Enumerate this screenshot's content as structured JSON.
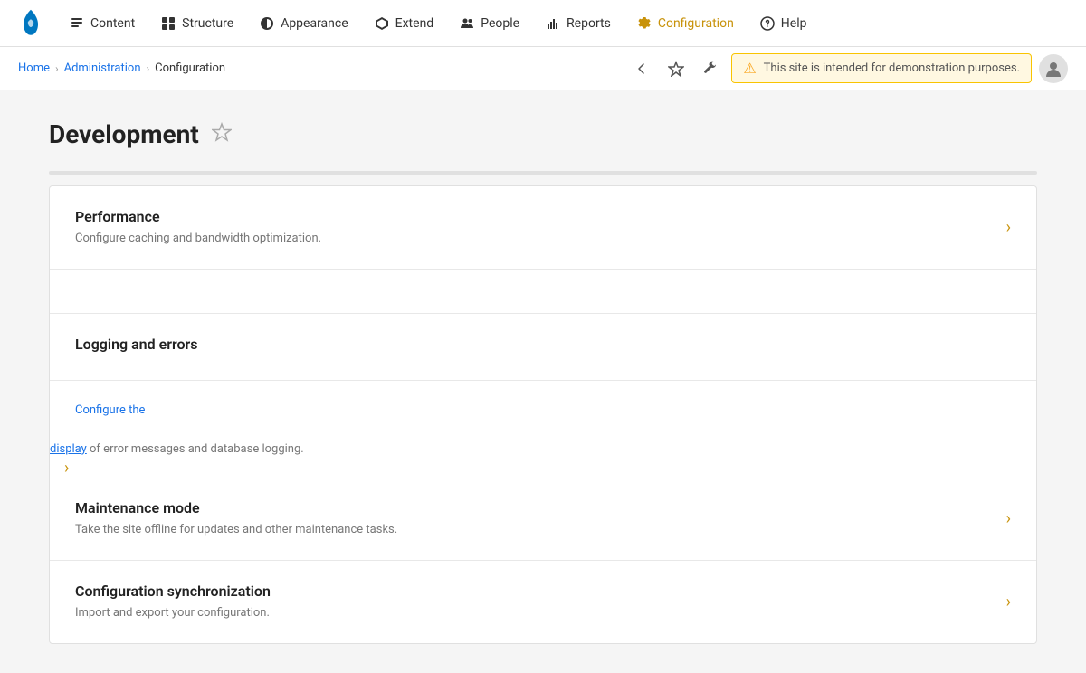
{
  "logo": {
    "alt": "Drupal logo"
  },
  "nav": {
    "items": [
      {
        "id": "content",
        "label": "Content",
        "icon": "content-icon"
      },
      {
        "id": "structure",
        "label": "Structure",
        "icon": "structure-icon"
      },
      {
        "id": "appearance",
        "label": "Appearance",
        "icon": "appearance-icon"
      },
      {
        "id": "extend",
        "label": "Extend",
        "icon": "extend-icon"
      },
      {
        "id": "people",
        "label": "People",
        "icon": "people-icon"
      },
      {
        "id": "reports",
        "label": "Reports",
        "icon": "reports-icon"
      },
      {
        "id": "configuration",
        "label": "Configuration",
        "icon": "configuration-icon",
        "active": true
      },
      {
        "id": "help",
        "label": "Help",
        "icon": "help-icon"
      }
    ]
  },
  "toolbar": {
    "breadcrumbs": [
      {
        "label": "Home",
        "href": "#"
      },
      {
        "label": "Administration",
        "href": "#"
      },
      {
        "label": "Configuration",
        "href": "#"
      }
    ],
    "demo_notice": "This site is intended for demonstration purposes.",
    "back_title": "Back",
    "bookmark_title": "Bookmark",
    "tool_title": "Tools"
  },
  "page": {
    "title": "Development",
    "star_title": "Bookmark this page"
  },
  "cards": [
    {
      "id": "performance",
      "title": "Performance",
      "description": "Configure caching and bandwidth optimization."
    },
    {
      "id": "logging-errors",
      "title": "Logging and errors",
      "description": "Configure the display of error messages and database logging."
    },
    {
      "id": "maintenance-mode",
      "title": "Maintenance mode",
      "description": "Take the site offline for updates and other maintenance tasks."
    },
    {
      "id": "config-sync",
      "title": "Configuration synchronization",
      "description": "Import and export your configuration."
    }
  ]
}
